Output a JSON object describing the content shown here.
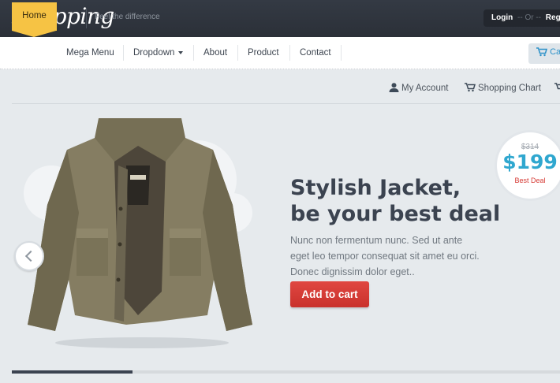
{
  "header": {
    "logo": "Shopping",
    "tagline": "Feel the difference",
    "login": "Login",
    "or": "-- Or --",
    "register": "Regist"
  },
  "nav": {
    "items": [
      "Home",
      "Mega Menu",
      "Dropdown",
      "About",
      "Product",
      "Contact"
    ],
    "cart_label": "Ca"
  },
  "account": {
    "my_account": "My Account",
    "shopping_chart": "Shopping Chart"
  },
  "hero": {
    "headline_line1": "Stylish Jacket,",
    "headline_line2": "be your best deal",
    "description": "Nunc non fermentum nunc. Sed ut ante eget leo tempor consequat sit amet eu orci. Donec dignissim dolor eget..",
    "cta": "Add to cart",
    "old_price": "$314",
    "new_price": "$199",
    "deal_label": "Best Deal",
    "slide_progress": 0.22
  },
  "colors": {
    "accent_yellow": "#f6c344",
    "price_blue": "#2fa7cf",
    "cta_red": "#d63a34",
    "topbar": "#2f343d"
  },
  "icons": [
    "user-icon",
    "cart-icon",
    "chevron-left-icon"
  ]
}
